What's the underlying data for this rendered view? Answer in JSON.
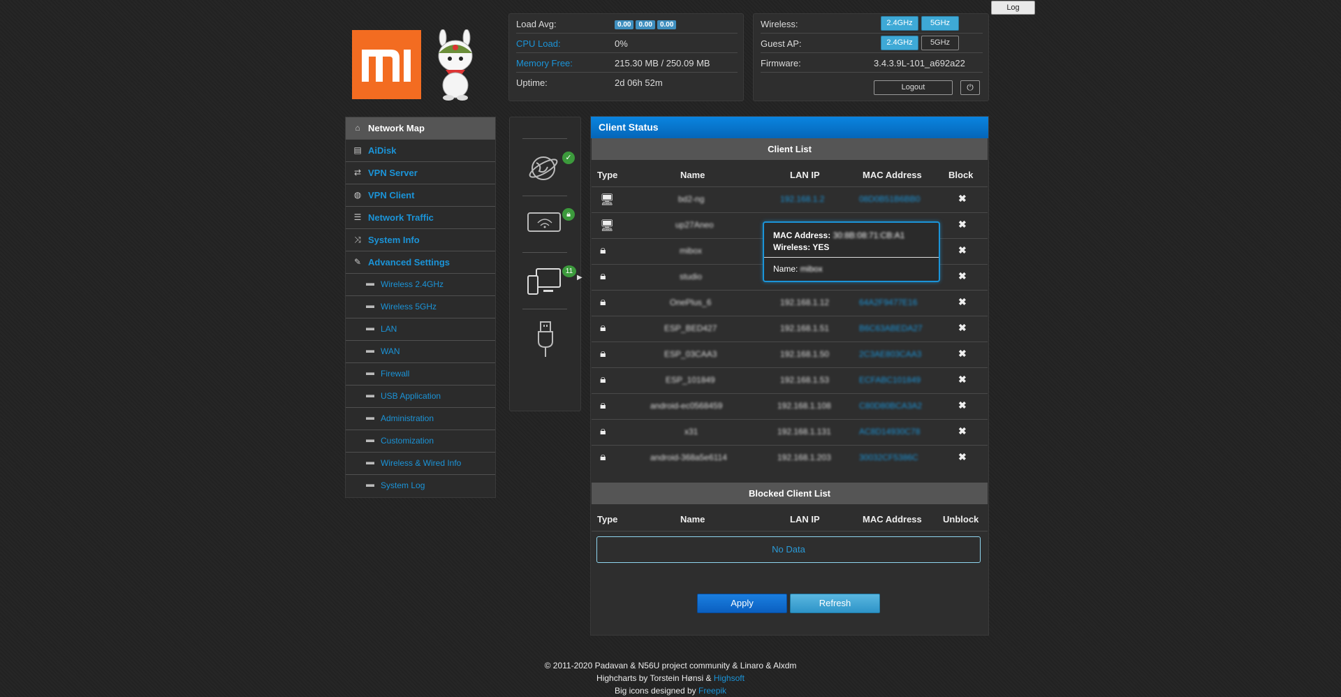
{
  "header": {
    "log_label": "Log"
  },
  "stats": {
    "load_avg_label": "Load Avg:",
    "load_values": [
      "0.00",
      "0.00",
      "0.00"
    ],
    "cpu_label": "CPU Load:",
    "cpu_value": "0%",
    "memory_label": "Memory Free:",
    "memory_value": "215.30 MB / 250.09 MB",
    "uptime_label": "Uptime:",
    "uptime_value": "2d 06h 52m"
  },
  "wireless_status": {
    "wireless_label": "Wireless:",
    "guest_label": "Guest AP:",
    "band_24": "2.4GHz",
    "band_5": "5GHz",
    "firmware_label": "Firmware:",
    "firmware_value": "3.4.3.9L-101_a692a22",
    "logout_label": "Logout",
    "power_icon": "power-icon"
  },
  "menu": {
    "items": [
      {
        "label": "Network Map",
        "icon": "home-icon"
      },
      {
        "label": "AiDisk",
        "icon": "disk-icon"
      },
      {
        "label": "VPN Server",
        "icon": "retweet-icon"
      },
      {
        "label": "VPN Client",
        "icon": "globe-icon"
      },
      {
        "label": "Network Traffic",
        "icon": "tasks-icon"
      },
      {
        "label": "System Info",
        "icon": "random-icon"
      },
      {
        "label": "Advanced Settings",
        "icon": "wrench-icon"
      }
    ],
    "sub_items": [
      "Wireless 2.4GHz",
      "Wireless 5GHz",
      "LAN",
      "WAN",
      "Firewall",
      "USB Application",
      "Administration",
      "Customization",
      "Wireless & Wired Info",
      "System Log"
    ]
  },
  "icon_panel": {
    "clients_count": "11"
  },
  "client_status": {
    "title": "Client Status",
    "client_list_title": "Client List",
    "columns": [
      "Type",
      "Name",
      "LAN IP",
      "MAC Address",
      "Block"
    ],
    "rows": [
      {
        "type": "desktop-icon",
        "name": "bd2-ng",
        "ip": "192.168.1.2",
        "mac": "08D0B51B6BB0"
      },
      {
        "type": "desktop-icon",
        "name": "up27Aneo",
        "ip": "",
        "mac": ""
      },
      {
        "type": "lock-icon",
        "name": "mibox",
        "ip": "",
        "mac": ""
      },
      {
        "type": "lock-icon",
        "name": "studio",
        "ip": "",
        "mac": ""
      },
      {
        "type": "lock-icon",
        "name": "OnePlus_6",
        "ip": "192.168.1.12",
        "mac": "64A2F9477E16"
      },
      {
        "type": "lock-icon",
        "name": "ESP_BED427",
        "ip": "192.168.1.51",
        "mac": "B6C63ABEDA27"
      },
      {
        "type": "lock-icon",
        "name": "ESP_03CAA3",
        "ip": "192.168.1.50",
        "mac": "2C3AE803CAA3"
      },
      {
        "type": "lock-icon",
        "name": "ESP_101849",
        "ip": "192.168.1.53",
        "mac": "ECFABC101849"
      },
      {
        "type": "lock-icon",
        "name": "android-ec0568459",
        "ip": "192.168.1.108",
        "mac": "C80D80BCA3A2"
      },
      {
        "type": "lock-icon",
        "name": "x31",
        "ip": "192.168.1.131",
        "mac": "AC8D14930C78"
      },
      {
        "type": "lock-icon",
        "name": "android-368a5e6114",
        "ip": "192.168.1.203",
        "mac": "30032CF5386C"
      }
    ],
    "blocked_title": "Blocked Client List",
    "blocked_columns": [
      "Type",
      "Name",
      "LAN IP",
      "MAC Address",
      "Unblock"
    ],
    "no_data": "No Data",
    "apply_label": "Apply",
    "refresh_label": "Refresh"
  },
  "tooltip": {
    "mac_label": "MAC Address:",
    "mac_value": "30:8B:08:71:CB:A1",
    "wireless_label": "Wireless:",
    "wireless_value": "YES",
    "name_label": "Name:",
    "name_value": "mibox"
  },
  "footer": {
    "line1": "© 2011-2020 Padavan & N56U project community & Linaro & Alxdm",
    "line2_prefix": "Highcharts by Torstein Hønsi &",
    "line2_link": "Highsoft",
    "line3_prefix": "Big icons designed by",
    "line3_link": "Freepik"
  }
}
